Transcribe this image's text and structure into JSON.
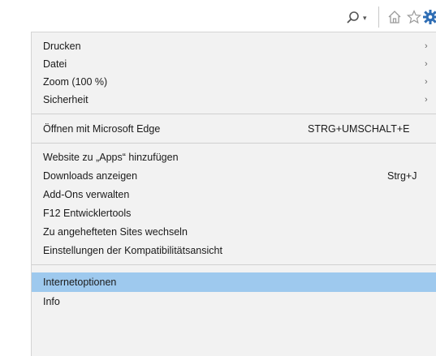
{
  "toolbar": {
    "search_icon": "search-icon",
    "dropdown_icon": "chevron-down-icon",
    "home_icon": "home-icon",
    "favorites_icon": "star-icon",
    "settings_icon": "gear-icon",
    "settings_color": "#2e6db4"
  },
  "menu": {
    "group1": [
      {
        "label": "Drucken",
        "submenu": true
      },
      {
        "label": "Datei",
        "submenu": true
      },
      {
        "label": "Zoom (100 %)",
        "submenu": true
      },
      {
        "label": "Sicherheit",
        "submenu": true
      }
    ],
    "group2": [
      {
        "label": "Öffnen mit Microsoft Edge",
        "shortcut": "STRG+UMSCHALT+E"
      }
    ],
    "group3": [
      {
        "label": "Website zu „Apps“ hinzufügen"
      },
      {
        "label": "Downloads anzeigen",
        "shortcut": "Strg+J"
      },
      {
        "label": "Add-Ons verwalten"
      },
      {
        "label": "F12 Entwicklertools"
      },
      {
        "label": "Zu angehefteten Sites wechseln"
      },
      {
        "label": "Einstellungen der Kompatibilitätsansicht"
      }
    ],
    "group4": [
      {
        "label": "Internetoptionen",
        "highlighted": true
      },
      {
        "label": "Info"
      }
    ],
    "submenu_arrow": "›",
    "highlight_color": "#9ec9ee"
  }
}
